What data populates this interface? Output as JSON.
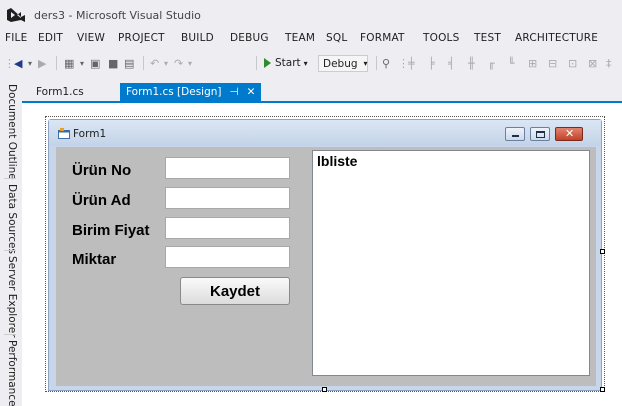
{
  "window": {
    "title": "ders3 - Microsoft Visual Studio"
  },
  "menu": [
    "FILE",
    "EDIT",
    "VIEW",
    "PROJECT",
    "BUILD",
    "DEBUG",
    "TEAM",
    "SQL",
    "FORMAT",
    "TOOLS",
    "TEST",
    "ARCHITECTURE"
  ],
  "toolbar": {
    "start_label": "Start",
    "config_value": "Debug"
  },
  "side_tabs": [
    "Document Outline",
    "Data Sources",
    "Server Explorer",
    "Performance E"
  ],
  "tabs": [
    {
      "label": "Form1.cs",
      "active": false
    },
    {
      "label": "Form1.cs [Design]",
      "active": true,
      "pin": "⊣",
      "close": "✕"
    }
  ],
  "form": {
    "title": "Form1",
    "labels": [
      "Ürün No",
      "Ürün Ad",
      "Birim Fiyat",
      "Miktar"
    ],
    "save_button": "Kaydet",
    "listbox_text": "lbliste"
  },
  "colors": {
    "accent": "#007acc",
    "form_client": "#bdbdbd",
    "close_button": "#c2412a"
  }
}
